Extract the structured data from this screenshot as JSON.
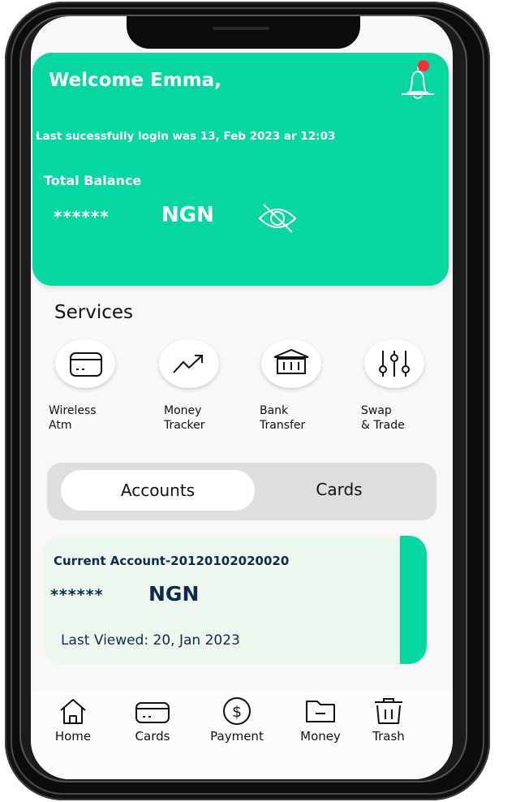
{
  "header": {
    "welcome": "Welcome Emma,",
    "last_login": "Last sucessfully login was 13, Feb 2023 ar 12:03",
    "balance_label": "Total Balance",
    "balance_masked": "******",
    "balance_currency": "NGN",
    "accent": "#06d6a0",
    "notification_dot": "#ff2d3d"
  },
  "services": {
    "title": "Services",
    "items": [
      {
        "label": "Wireless\nAtm",
        "icon": "card-icon"
      },
      {
        "label": "Money\nTracker",
        "icon": "trending-up-icon"
      },
      {
        "label": "Bank\nTransfer",
        "icon": "bank-icon"
      },
      {
        "label": "Swap\n& Trade",
        "icon": "sliders-icon"
      }
    ]
  },
  "tabs": {
    "accounts": "Accounts",
    "cards": "Cards",
    "selected": "Accounts"
  },
  "account": {
    "name": "Current Account-20120102020020",
    "masked": "******",
    "currency": "NGN",
    "last_viewed_label": "Last Viewed",
    "last_viewed": ": 20, Jan 2023"
  },
  "nav": [
    {
      "label": "Home",
      "icon": "home-icon"
    },
    {
      "label": "Cards",
      "icon": "card-icon"
    },
    {
      "label": "Payment",
      "icon": "dollar-icon"
    },
    {
      "label": "Money",
      "icon": "folder-icon"
    },
    {
      "label": "Trash",
      "icon": "trash-icon"
    }
  ]
}
